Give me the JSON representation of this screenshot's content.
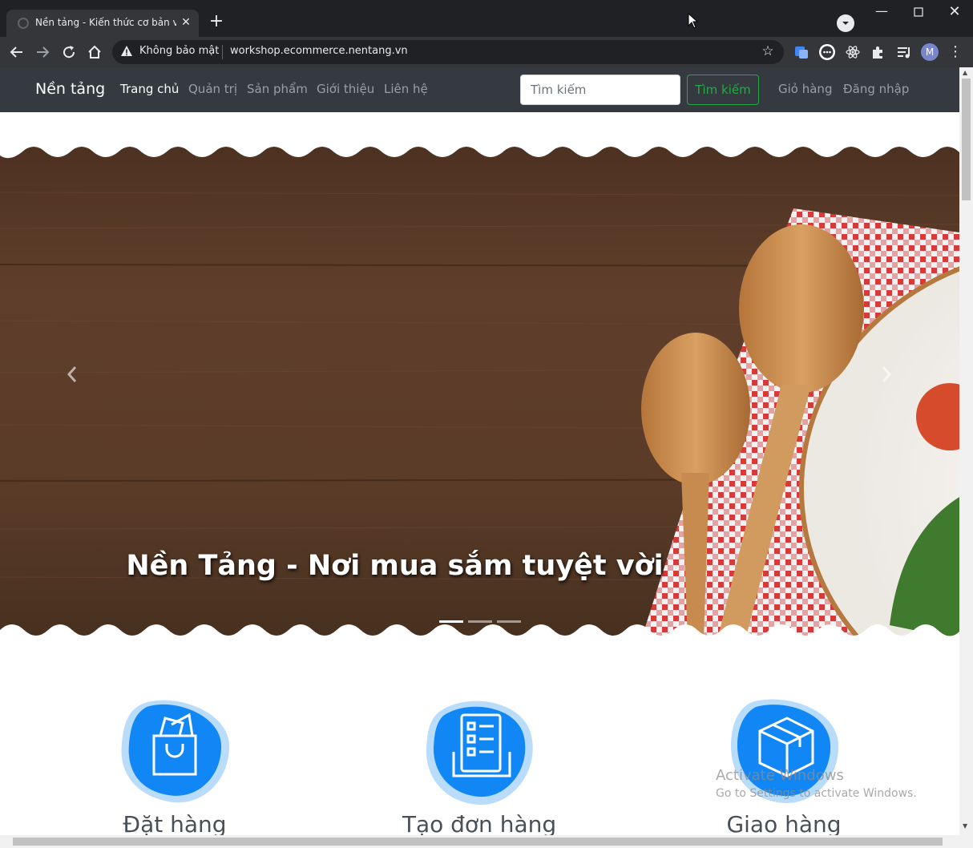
{
  "browser": {
    "tab_title": "Nền tảng - Kiến thức cơ bản về Web",
    "security_label": "Không bảo mật",
    "url": "workshop.ecommerce.nentang.vn",
    "profile_initial": "M"
  },
  "navbar": {
    "brand": "Nền tảng",
    "links": [
      "Trang chủ",
      "Quản trị",
      "Sản phẩm",
      "Giới thiệu",
      "Liên hệ"
    ],
    "search_placeholder": "Tìm kiếm",
    "search_button": "Tìm kiếm",
    "cart": "Giỏ hàng",
    "login": "Đăng nhập"
  },
  "carousel": {
    "caption": "Nền Tảng - Nơi mua sắm tuyệt vời",
    "slide_count": 3,
    "active_slide": 1
  },
  "features": [
    {
      "title": "Đặt hàng",
      "icon": "shopping-bag-icon"
    },
    {
      "title": "Tạo đơn hàng",
      "icon": "order-checklist-icon"
    },
    {
      "title": "Giao hàng",
      "icon": "delivery-box-icon"
    }
  ],
  "os_watermark": {
    "title": "Activate Windows",
    "subtitle": "Go to Settings to activate Windows."
  },
  "colors": {
    "navbar_bg": "#343a40",
    "feature_blue": "#1087f4",
    "search_green": "#28a745",
    "browser_dark": "#202124"
  }
}
